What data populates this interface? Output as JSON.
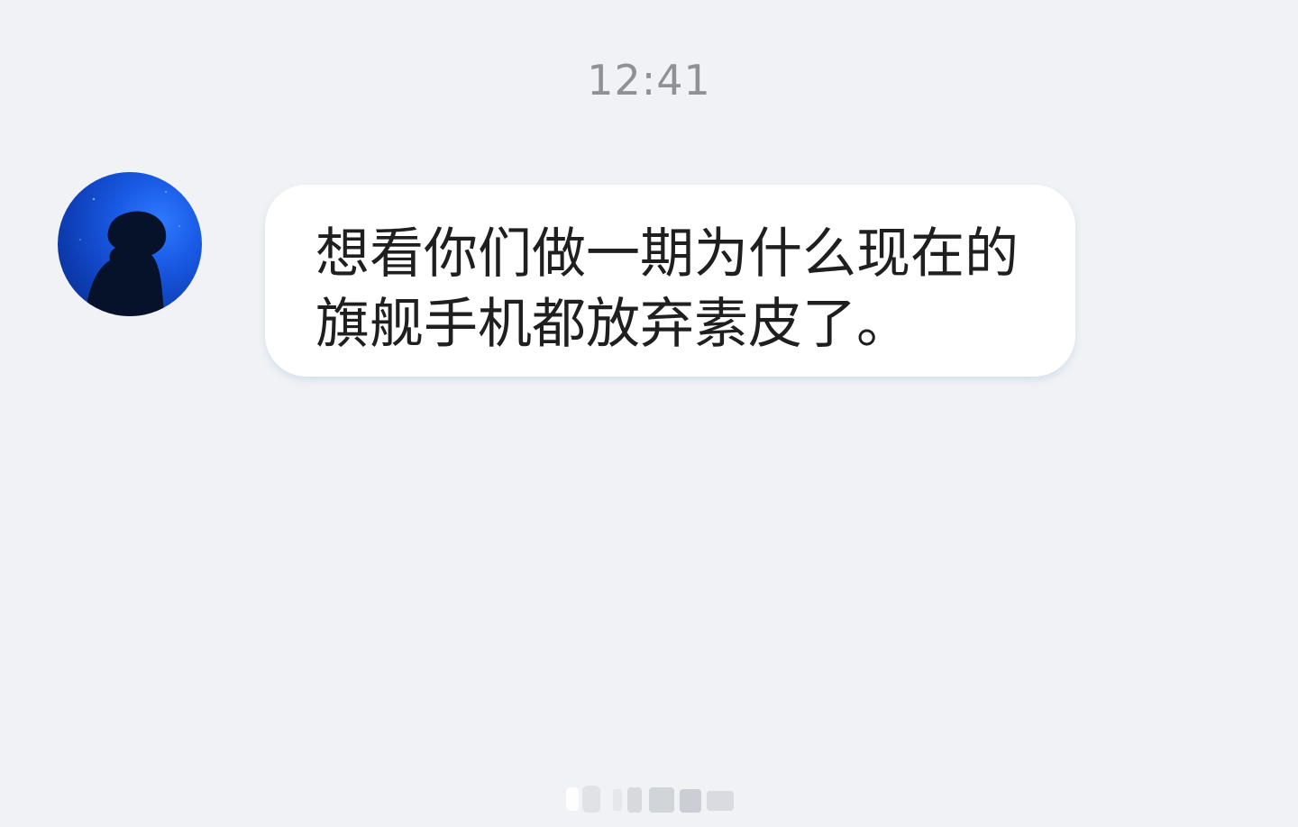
{
  "chat": {
    "timestamp": "12:41",
    "messages": [
      {
        "sender": "other",
        "avatar_icon": "silhouette-avatar-icon",
        "text": "想看你们做一期为什么现在的旗舰手机都放弃素皮了。"
      }
    ]
  },
  "colors": {
    "background": "#f0f2f5",
    "bubble": "#ffffff",
    "text": "#1f1f1f",
    "timestamp": "#8e9196",
    "avatar_blue": "#1a5be6"
  }
}
